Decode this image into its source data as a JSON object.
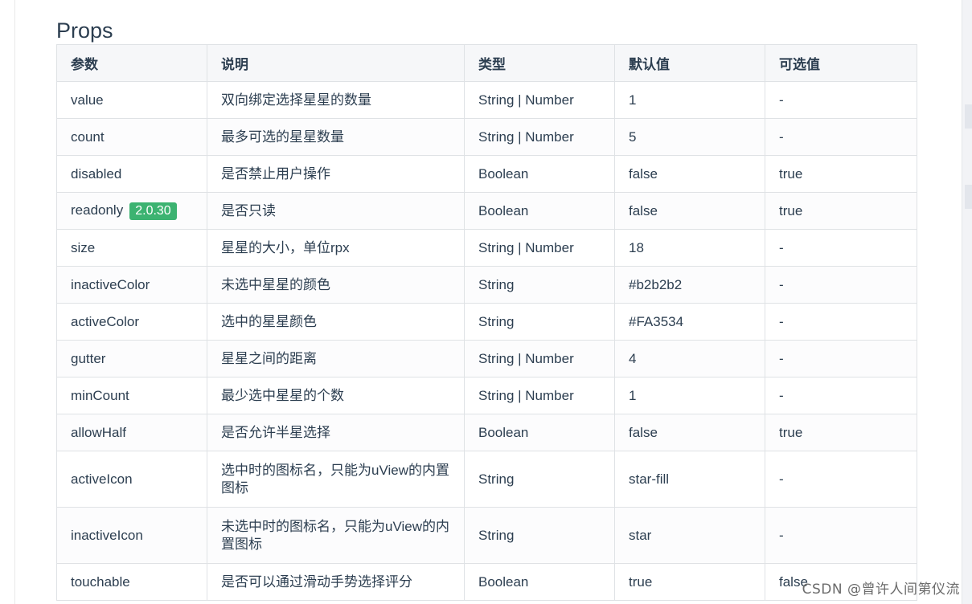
{
  "page": {
    "title": "Props"
  },
  "table": {
    "headers": [
      "参数",
      "说明",
      "类型",
      "默认值",
      "可选值"
    ],
    "rows": [
      {
        "param": "value",
        "badge": "",
        "desc": "双向绑定选择星星的数量",
        "type": "String | Number",
        "default": "1",
        "options": "-"
      },
      {
        "param": "count",
        "badge": "",
        "desc": "最多可选的星星数量",
        "type": "String | Number",
        "default": "5",
        "options": "-"
      },
      {
        "param": "disabled",
        "badge": "",
        "desc": "是否禁止用户操作",
        "type": "Boolean",
        "default": "false",
        "options": "true"
      },
      {
        "param": "readonly",
        "badge": "2.0.30",
        "desc": "是否只读",
        "type": "Boolean",
        "default": "false",
        "options": "true"
      },
      {
        "param": "size",
        "badge": "",
        "desc": "星星的大小，单位rpx",
        "type": "String | Number",
        "default": "18",
        "options": "-"
      },
      {
        "param": "inactiveColor",
        "badge": "",
        "desc": "未选中星星的颜色",
        "type": "String",
        "default": "#b2b2b2",
        "options": "-"
      },
      {
        "param": "activeColor",
        "badge": "",
        "desc": "选中的星星颜色",
        "type": "String",
        "default": "#FA3534",
        "options": "-"
      },
      {
        "param": "gutter",
        "badge": "",
        "desc": "星星之间的距离",
        "type": "String | Number",
        "default": "4",
        "options": "-"
      },
      {
        "param": "minCount",
        "badge": "",
        "desc": "最少选中星星的个数",
        "type": "String | Number",
        "default": "1",
        "options": "-"
      },
      {
        "param": "allowHalf",
        "badge": "",
        "desc": "是否允许半星选择",
        "type": "Boolean",
        "default": "false",
        "options": "true"
      },
      {
        "param": "activeIcon",
        "badge": "",
        "desc": "选中时的图标名，只能为uView的内置图标",
        "type": "String",
        "default": "star-fill",
        "options": "-"
      },
      {
        "param": "inactiveIcon",
        "badge": "",
        "desc": "未选中时的图标名，只能为uView的内置图标",
        "type": "String",
        "default": "star",
        "options": "-"
      },
      {
        "param": "touchable",
        "badge": "",
        "desc": "是否可以通过滑动手势选择评分",
        "type": "Boolean",
        "default": "true",
        "options": "false"
      }
    ]
  },
  "watermark": "CSDN @曾许人间第仪流",
  "colors": {
    "text": "#2c3e50",
    "border": "#dfe2e5",
    "header_bg": "#f6f7f9",
    "badge_bg": "#3cb371"
  }
}
